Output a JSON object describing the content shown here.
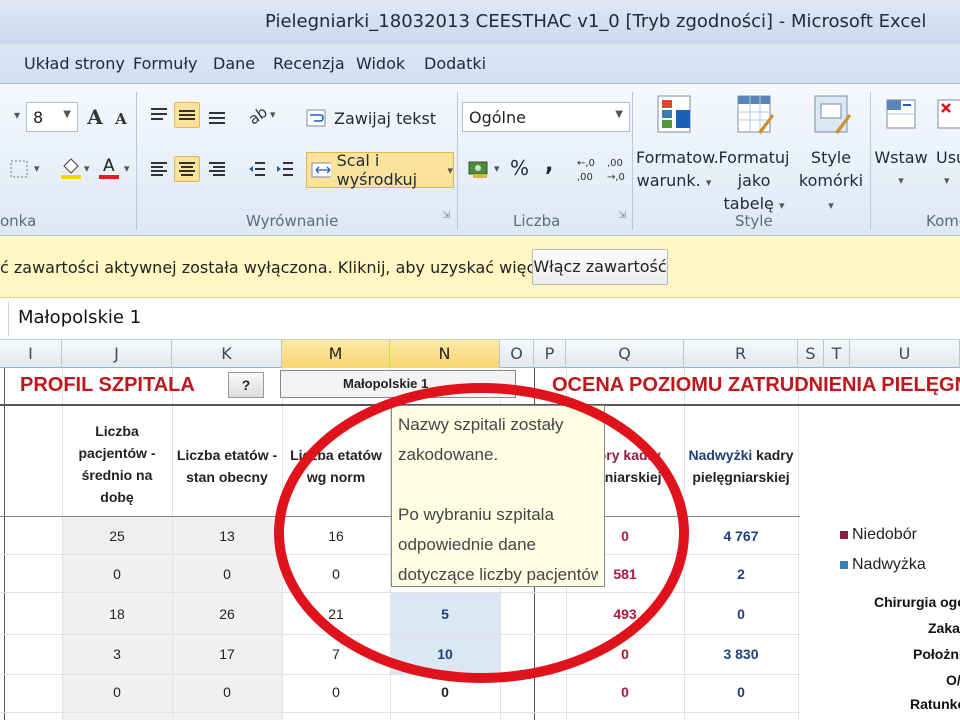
{
  "window": {
    "title": "Pielegniarki_18032013 CEESTHAC v1_0  [Tryb zgodności] - Microsoft Excel"
  },
  "tabs": [
    {
      "label": "Układ strony"
    },
    {
      "label": "Formuły"
    },
    {
      "label": "Dane"
    },
    {
      "label": "Recenzja"
    },
    {
      "label": "Widok"
    },
    {
      "label": "Dodatki"
    }
  ],
  "ribbon": {
    "font_size": "8",
    "number_format": "Ogólne",
    "wrap_text": "Zawijaj tekst",
    "merge_center": "Scal i wyśrodkuj",
    "percent": "%",
    "comma": ",",
    "conditional_format": "Formatow.\nwarunk.",
    "conditional_format_l1": "Formatow.",
    "conditional_format_l2": "warunk.",
    "format_table_l1": "Formatuj",
    "format_table_l2": "jako tabelę",
    "cell_styles_l1": "Style",
    "cell_styles_l2": "komórki",
    "insert_label": "Wstaw",
    "delete_label": "Usu",
    "groups": {
      "font": "onka",
      "alignment": "Wyrównanie",
      "number": "Liczba",
      "styles": "Style",
      "cells": "Komo"
    }
  },
  "security_bar": {
    "message": "ć zawartości aktywnej została wyłączona. Kliknij, aby uzyskać więcej szczegółów.",
    "button": "Włącz zawartość"
  },
  "formula_bar": {
    "value": "Małopolskie 1"
  },
  "columns": [
    "I",
    "J",
    "K",
    "M",
    "N",
    "O",
    "P",
    "Q",
    "R",
    "S",
    "T",
    "U"
  ],
  "sheet": {
    "title_left": "PROFIL SZPITALA",
    "help_button": "?",
    "dropdown_value": "Małopolskie 1",
    "title_right": "OCENA POZIOMU ZATRUDNIENIA PIELĘGNIAR",
    "headers": {
      "j": [
        "Liczba",
        "pacjentów -",
        "średnio na",
        "dobę"
      ],
      "k": [
        "Liczba etatów -",
        "stan obecny"
      ],
      "m": [
        "Liczba etatów",
        "wg norm"
      ],
      "q": [
        "bory kadry",
        "ęgniarskiej"
      ],
      "r_a": "Nadwyżki",
      "r_b": " kadry",
      "r_c": "pielęgniarskiej"
    },
    "rows": [
      {
        "j": "25",
        "k": "13",
        "m": "16",
        "n": "",
        "q": "0",
        "r": "4 767"
      },
      {
        "j": "0",
        "k": "0",
        "m": "0",
        "n": "",
        "q": "581",
        "r": "2"
      },
      {
        "j": "18",
        "k": "26",
        "m": "21",
        "n": "5",
        "q": "493",
        "r": "0"
      },
      {
        "j": "3",
        "k": "17",
        "m": "7",
        "n": "10",
        "q": "0",
        "r": "3 830"
      },
      {
        "j": "0",
        "k": "0",
        "m": "0",
        "n": "0",
        "q": "0",
        "r": "0"
      }
    ],
    "legend": [
      {
        "label": "Niedobór",
        "color": "#8b1e3f"
      },
      {
        "label": "Nadwyżka",
        "color": "#3a7fb0"
      }
    ],
    "categories": [
      "Chirurgia ogó",
      "Zaka",
      "Położni",
      "O/",
      "Ratunko"
    ]
  },
  "tooltip": {
    "line1": "Nazwy szpitali zostały",
    "line2": "zakodowane.",
    "line3": "Po wybraniu szpitala",
    "line4": "odpowiednie dane",
    "line5": "dotyczące liczby pacjentów"
  },
  "colors": {
    "accent_red": "#c0171c",
    "highlight": "#fbe39b",
    "annotation_ring": "#e0121b"
  }
}
